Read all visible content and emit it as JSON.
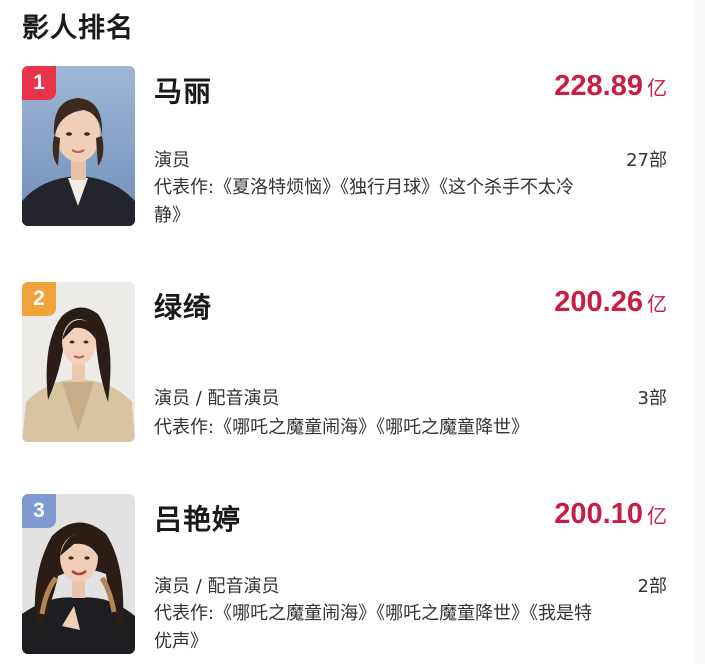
{
  "page": {
    "title": "影人排名"
  },
  "colors": {
    "accent": "#c81e45",
    "rank1": "#e8334a",
    "rank2": "#f2a23a",
    "rank3": "#7e9bd1"
  },
  "ranking": [
    {
      "rank": "1",
      "name": "马丽",
      "box_office": "228.89",
      "unit": "亿",
      "role": "演员",
      "count": "27部",
      "works": "代表作:《夏洛特烦恼》《独行月球》《这个杀手不太冷静》",
      "photo_icon": "portrait-photo"
    },
    {
      "rank": "2",
      "name": "绿绮",
      "box_office": "200.26",
      "unit": "亿",
      "role": "演员 / 配音演员",
      "count": "3部",
      "works": "代表作:《哪吒之魔童闹海》《哪吒之魔童降世》",
      "photo_icon": "portrait-photo"
    },
    {
      "rank": "3",
      "name": "吕艳婷",
      "box_office": "200.10",
      "unit": "亿",
      "role": "演员 / 配音演员",
      "count": "2部",
      "works": "代表作:《哪吒之魔童闹海》《哪吒之魔童降世》《我是特优声》",
      "photo_icon": "portrait-photo"
    }
  ]
}
